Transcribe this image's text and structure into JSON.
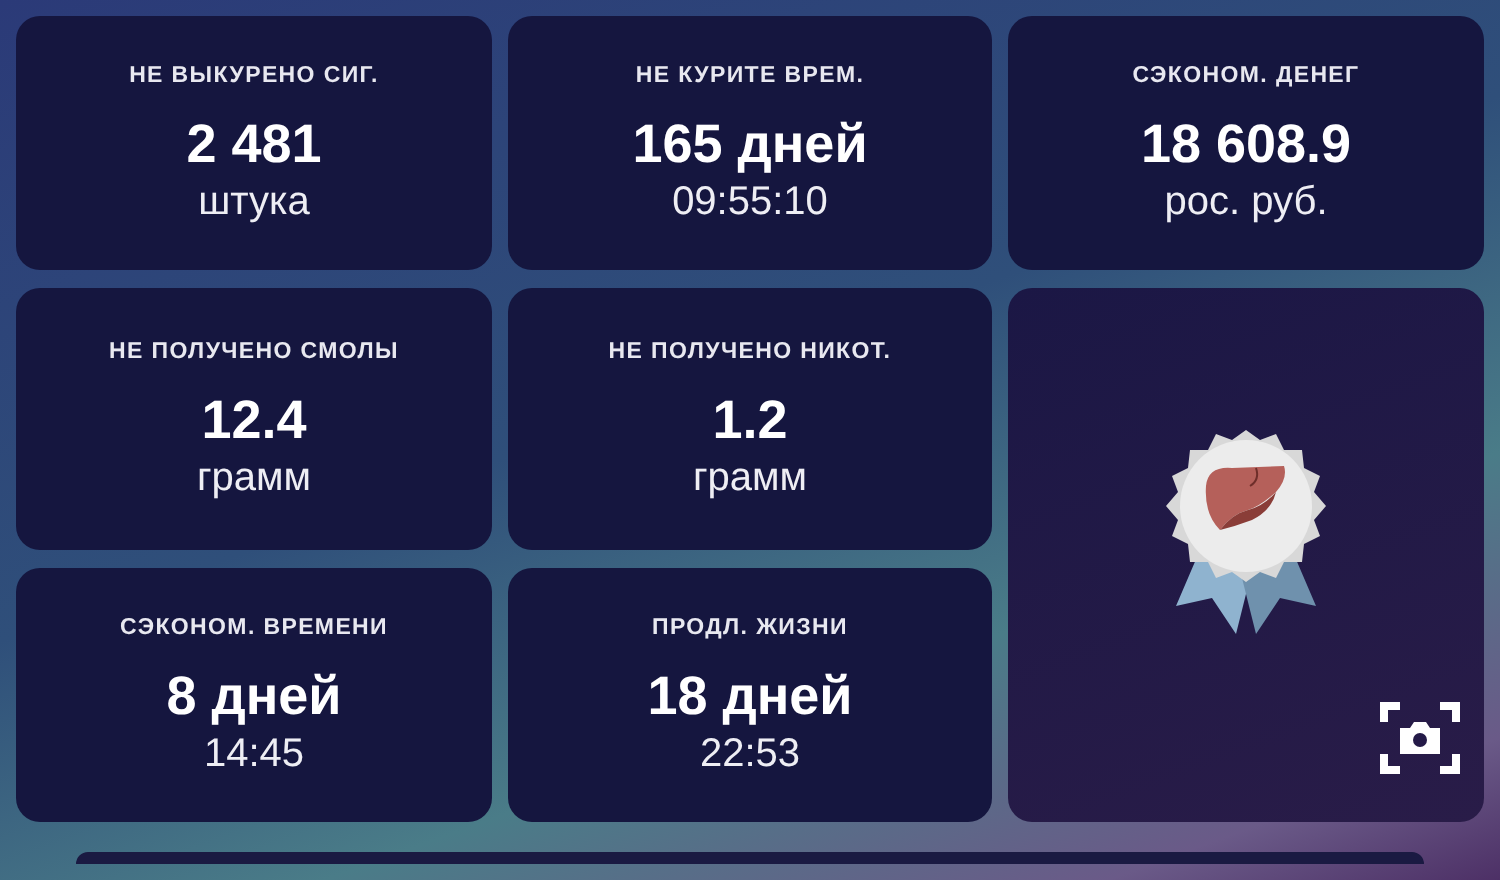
{
  "stats": [
    {
      "label": "НЕ ВЫКУРЕНО СИГ.",
      "value": "2 481",
      "unit": "штука"
    },
    {
      "label": "НЕ КУРИТЕ ВРЕМ.",
      "value": "165 дней",
      "unit": "09:55:10"
    },
    {
      "label": "СЭКОНОМ. ДЕНЕГ",
      "value": "18 608.9",
      "unit": "рос. руб."
    },
    {
      "label": "НЕ ПОЛУЧЕНО СМОЛЫ",
      "value": "12.4",
      "unit": "грамм"
    },
    {
      "label": "НЕ ПОЛУЧЕНО НИКОТ.",
      "value": "1.2",
      "unit": "грамм"
    },
    {
      "label": "СЭКОНОМ. ВРЕМЕНИ",
      "value": "8 дней",
      "unit": "14:45"
    },
    {
      "label": "ПРОДЛ. ЖИЗНИ",
      "value": "18 дней",
      "unit": "22:53"
    }
  ]
}
